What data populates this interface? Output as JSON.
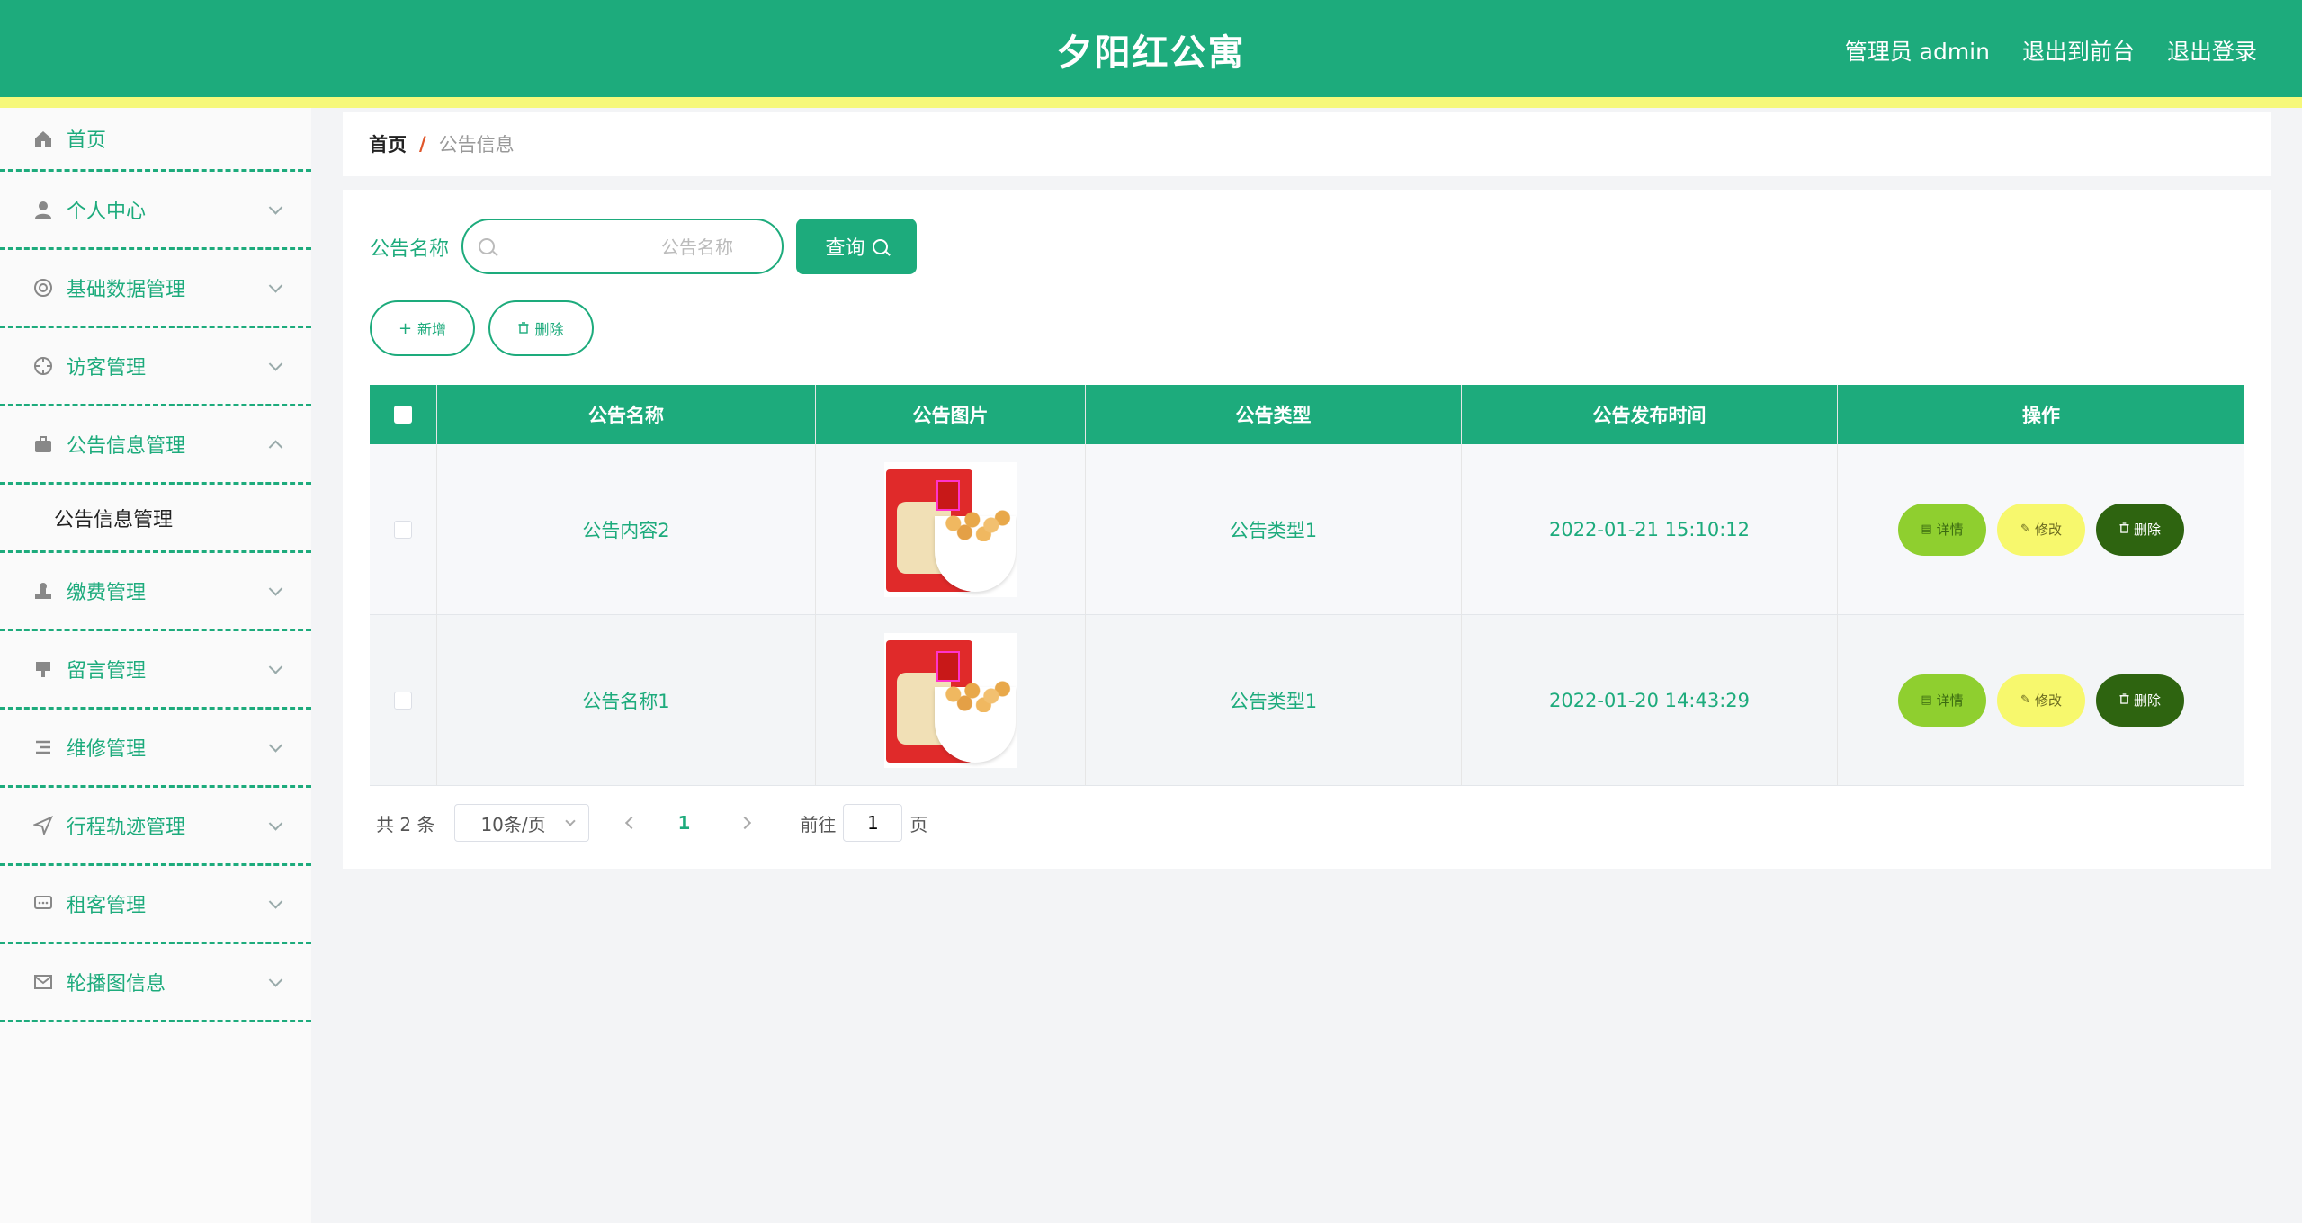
{
  "header": {
    "title": "夕阳红公寓",
    "admin_label": "管理员 admin",
    "front_label": "退出到前台",
    "logout_label": "退出登录"
  },
  "sidebar": {
    "items": [
      {
        "label": "首页",
        "icon": "home-icon"
      },
      {
        "label": "个人中心",
        "icon": "user-icon"
      },
      {
        "label": "基础数据管理",
        "icon": "lifebuoy-icon"
      },
      {
        "label": "访客管理",
        "icon": "target-icon"
      },
      {
        "label": "公告信息管理",
        "icon": "briefcase-icon"
      },
      {
        "label": "缴费管理",
        "icon": "stamp-icon"
      },
      {
        "label": "留言管理",
        "icon": "flag-icon"
      },
      {
        "label": "维修管理",
        "icon": "list-icon"
      },
      {
        "label": "行程轨迹管理",
        "icon": "navigation-icon"
      },
      {
        "label": "租客管理",
        "icon": "chat-icon"
      },
      {
        "label": "轮播图信息",
        "icon": "mail-icon"
      }
    ],
    "submenu_label": "公告信息管理"
  },
  "breadcrumb": {
    "home": "首页",
    "separator": "/",
    "current": "公告信息"
  },
  "search": {
    "label": "公告名称",
    "placeholder": "公告名称",
    "button_label": "查询"
  },
  "actions": {
    "add_label": "新增",
    "delete_label": "删除"
  },
  "table": {
    "columns": [
      "公告名称",
      "公告图片",
      "公告类型",
      "公告发布时间",
      "操作"
    ],
    "rows": [
      {
        "name": "公告内容2",
        "type": "公告类型1",
        "time": "2022-01-21 15:10:12"
      },
      {
        "name": "公告名称1",
        "type": "公告类型1",
        "time": "2022-01-20 14:43:29"
      }
    ],
    "detail_label": "详情",
    "edit_label": "修改",
    "delete_label": "删除"
  },
  "pagination": {
    "total": "共 2 条",
    "page_size": "10条/页",
    "current_page": "1",
    "goto_label": "前往",
    "goto_value": "1",
    "page_suffix": "页"
  },
  "colors": {
    "primary": "#1dab7c",
    "accent_strip": "#f6f87a",
    "detail_button": "#8fcf2f",
    "edit_button": "#f7f86d",
    "delete_button": "#2e6410"
  }
}
